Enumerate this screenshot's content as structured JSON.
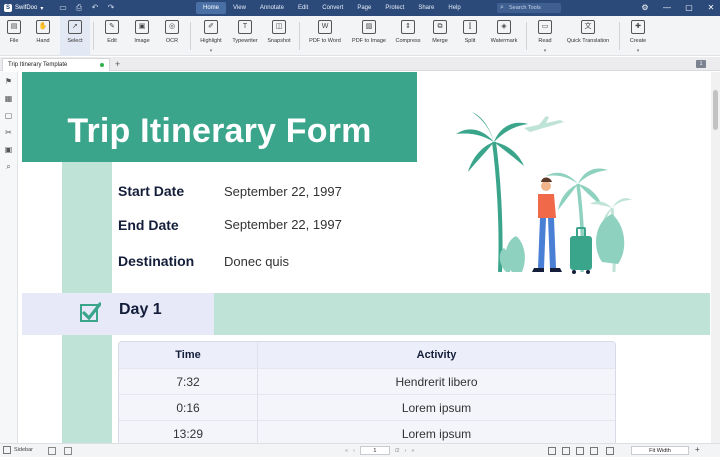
{
  "app": {
    "name": "SwifDoo",
    "menu_caret": "▾"
  },
  "quick_access": [
    "save-icon",
    "print-icon",
    "undo-icon",
    "redo-icon"
  ],
  "menu": [
    {
      "label": "Home",
      "active": true
    },
    {
      "label": "View"
    },
    {
      "label": "Annotate"
    },
    {
      "label": "Edit"
    },
    {
      "label": "Convert"
    },
    {
      "label": "Page"
    },
    {
      "label": "Protect"
    },
    {
      "label": "Share"
    },
    {
      "label": "Help"
    }
  ],
  "search": {
    "placeholder": "Search Tools"
  },
  "window_controls": [
    "⚙",
    "—",
    "▢",
    "✕"
  ],
  "toolbar": [
    {
      "label": "File",
      "icon": "file-icon",
      "glyph": "▤"
    },
    {
      "label": "Hand",
      "icon": "hand-icon",
      "glyph": "✋"
    },
    {
      "label": "Select",
      "icon": "cursor-icon",
      "glyph": "➚",
      "active": true
    },
    {
      "sep": true
    },
    {
      "label": "Edit",
      "icon": "edit-icon",
      "glyph": "✎"
    },
    {
      "label": "Image",
      "icon": "image-icon",
      "glyph": "▣"
    },
    {
      "label": "OCR",
      "icon": "ocr-icon",
      "glyph": "◎"
    },
    {
      "sep": true
    },
    {
      "label": "Highlight",
      "icon": "highlight-icon",
      "glyph": "✐",
      "caret": true
    },
    {
      "label": "Typewriter",
      "icon": "typewriter-icon",
      "glyph": "T"
    },
    {
      "label": "Snapshot",
      "icon": "snapshot-icon",
      "glyph": "◫"
    },
    {
      "sep": true
    },
    {
      "label": "PDF to Word",
      "icon": "pdf-to-word-icon",
      "glyph": "W"
    },
    {
      "label": "PDF to Image",
      "icon": "pdf-to-image-icon",
      "glyph": "▨"
    },
    {
      "label": "Compress",
      "icon": "compress-icon",
      "glyph": "⇕"
    },
    {
      "label": "Merge",
      "icon": "merge-icon",
      "glyph": "⧉"
    },
    {
      "label": "Split",
      "icon": "split-icon",
      "glyph": "⫿"
    },
    {
      "label": "Watermark",
      "icon": "watermark-icon",
      "glyph": "◈"
    },
    {
      "sep": true
    },
    {
      "label": "Read",
      "icon": "read-icon",
      "glyph": "▭",
      "caret": true
    },
    {
      "label": "Quick Translation",
      "icon": "translate-icon",
      "glyph": "文"
    },
    {
      "sep": true
    },
    {
      "label": "Create",
      "icon": "create-icon",
      "glyph": "✚",
      "caret": true
    }
  ],
  "tabs": {
    "doc_title": "Trip Itinerary Template",
    "add_label": "+",
    "count_badge": "1"
  },
  "left_tools": [
    {
      "icon": "bookmark-icon",
      "glyph": "⚑"
    },
    {
      "icon": "thumbnails-icon",
      "glyph": "▦"
    },
    {
      "icon": "comments-icon",
      "glyph": "▢"
    },
    {
      "icon": "attachment-icon",
      "glyph": "✂"
    },
    {
      "icon": "stamp-icon",
      "glyph": "▣"
    },
    {
      "icon": "search-icon",
      "glyph": "⌕"
    }
  ],
  "document": {
    "title": "Trip Itinerary Form",
    "start_label": "Start Date",
    "start_value": "September 22, 1997",
    "end_label": "End Date",
    "end_value": "September 22, 1997",
    "dest_label": "Destination",
    "dest_value": "Donec quis",
    "day_label": "Day 1",
    "table": {
      "headers": [
        "Time",
        "Activity"
      ],
      "rows": [
        [
          "7:32",
          "Hendrerit libero"
        ],
        [
          "0:16",
          "Lorem ipsum"
        ],
        [
          "13:29",
          "Lorem ipsum"
        ]
      ]
    },
    "colors": {
      "accent": "#3aa58b",
      "stripe": "#bfe3d7",
      "dark": "#141e3a",
      "lavender": "#e7e9f8"
    }
  },
  "statusbar": {
    "sidebar_label": "Sidebar",
    "page_current": "1",
    "page_total": "/2",
    "zoom": "Fit Width",
    "zoom_plus": "+"
  }
}
